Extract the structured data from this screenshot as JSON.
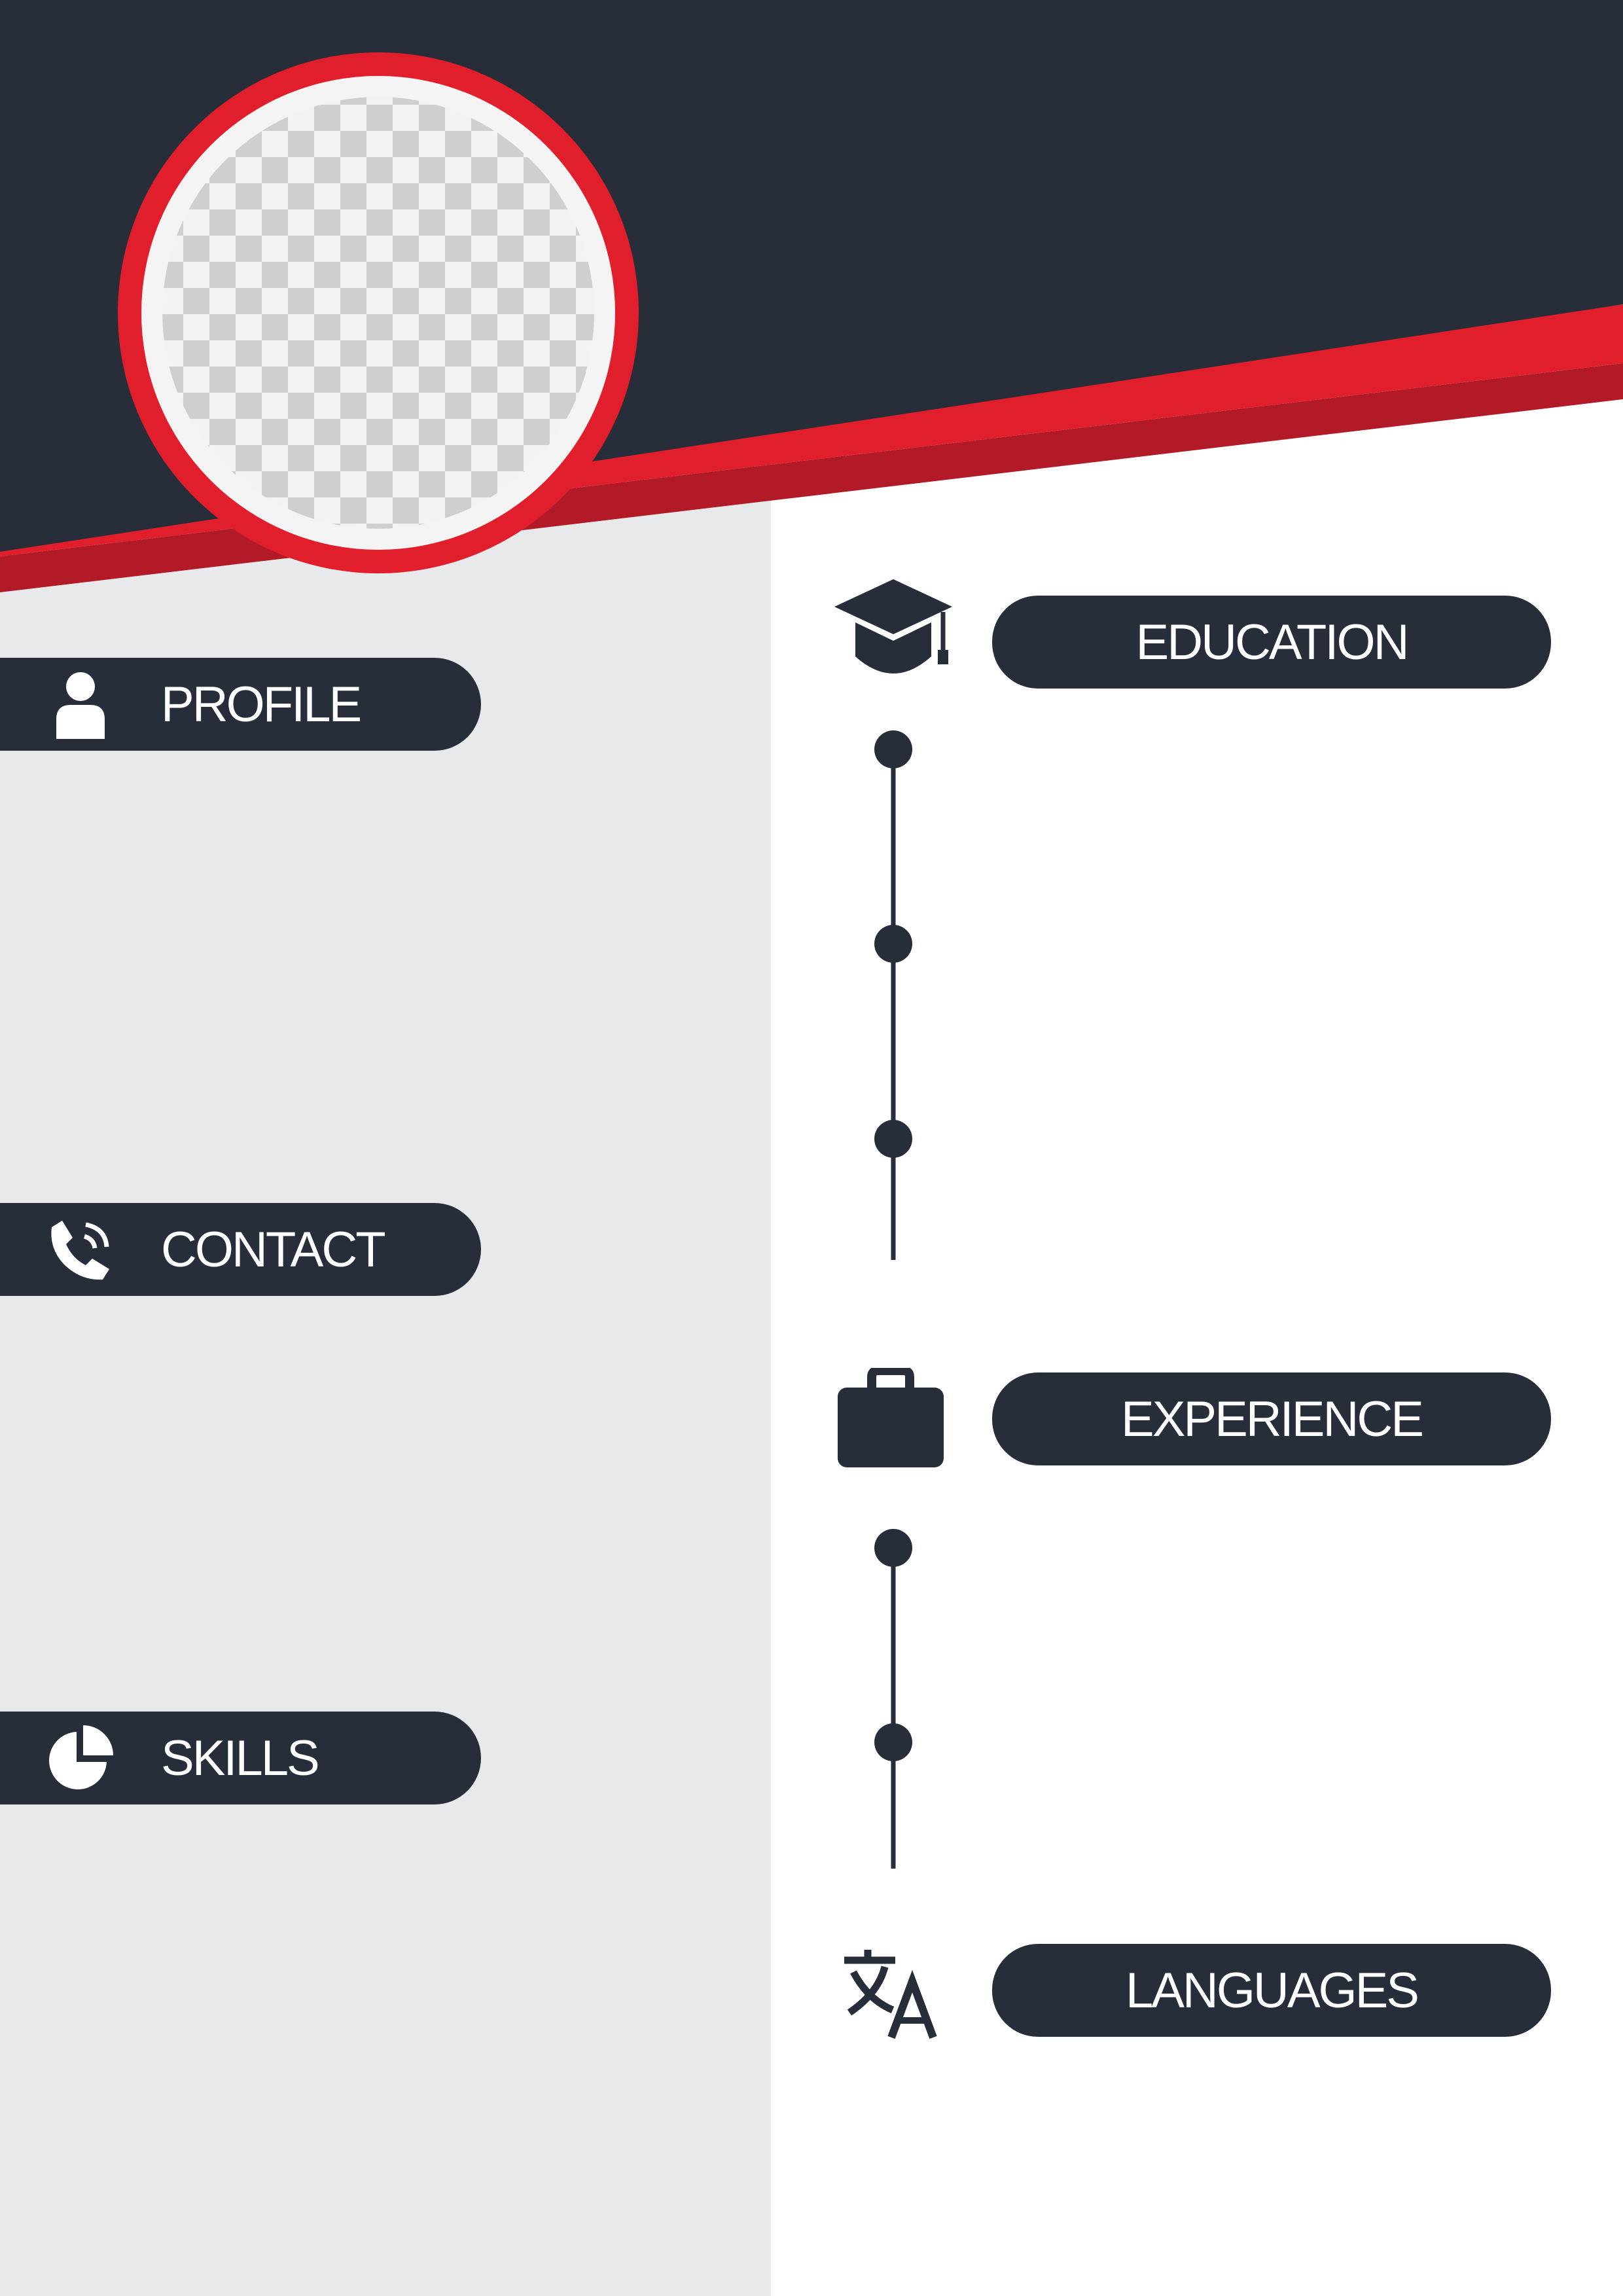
{
  "colors": {
    "header": "#272d39",
    "accent": "#e11f2c",
    "accent_dark": "#b11a26",
    "sidebar": "#e8e9eb",
    "page": "#ffffff",
    "text_on_dark": "#ffffff"
  },
  "photo": {
    "placeholder": "transparent-checkerboard"
  },
  "sidebar": {
    "sections": [
      {
        "label": "PROFILE",
        "icon": "person-icon"
      },
      {
        "label": "CONTACT",
        "icon": "phone-icon"
      },
      {
        "label": "SKILLS",
        "icon": "pie-chart-icon"
      }
    ]
  },
  "main": {
    "sections": [
      {
        "label": "EDUCATION",
        "icon": "graduation-cap-icon",
        "timeline_points": 3
      },
      {
        "label": "EXPERIENCE",
        "icon": "briefcase-icon",
        "timeline_points": 2
      },
      {
        "label": "LANGUAGES",
        "icon": "translate-icon",
        "timeline_points": 0
      }
    ]
  }
}
